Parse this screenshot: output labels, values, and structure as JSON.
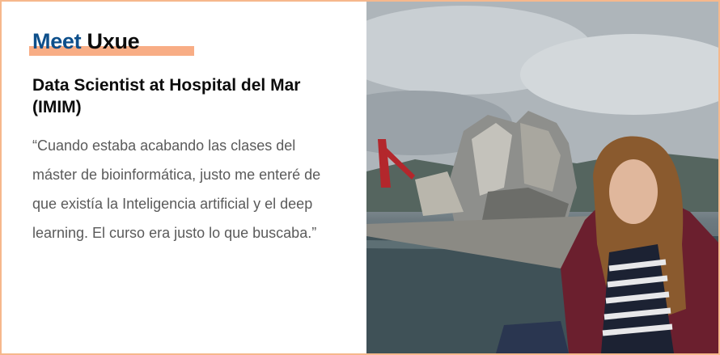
{
  "header": {
    "meet_word": "Meet",
    "name": "Uxue"
  },
  "role": "Data Scientist at Hospital del Mar (IMIM)",
  "quote": "“Cuando estaba acabando las clases del máster de bioinformática, justo me enteré de que existía la Inteligencia artificial y el deep learning. El curso era justo lo que buscaba.”",
  "colors": {
    "accent_bar": "#f8ad85",
    "border": "#f6b88c",
    "meet_blue": "#0d4f8b",
    "quote_gray": "#5a5a5a"
  },
  "photo": {
    "icon": "portrait-photo"
  }
}
